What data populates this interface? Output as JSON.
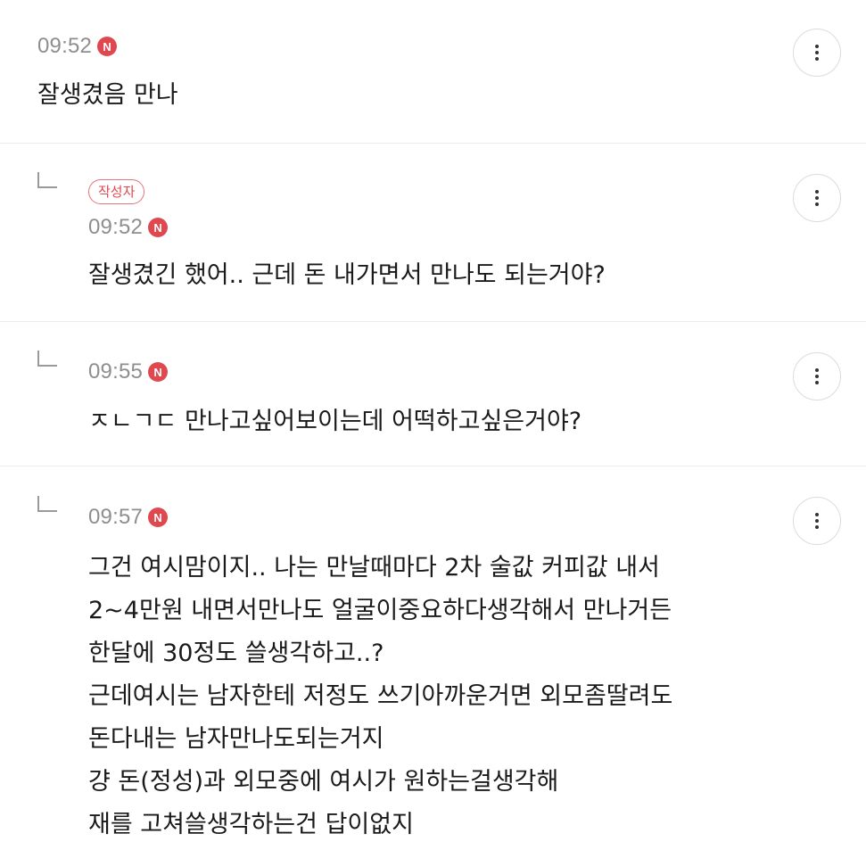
{
  "comments": [
    {
      "time": "09:52",
      "new_badge": "N",
      "text": "잘생겼음 만나"
    },
    {
      "author_badge": "작성자",
      "time": "09:52",
      "new_badge": "N",
      "text": "잘생겼긴 했어.. 근데 돈 내가면서 만나도 되는거야?"
    },
    {
      "time": "09:55",
      "new_badge": "N",
      "text": "ㅈㄴㄱㄷ 만나고싶어보이는데 어떡하고싶은거야?"
    },
    {
      "time": "09:57",
      "new_badge": "N",
      "lines": [
        "그건 여시맘이지.. 나는 만날때마다 2차 술값 커피값 내서",
        "2~4만원 내면서만나도 얼굴이중요하다생각해서 만나거든",
        "한달에 30정도 쓸생각하고..?",
        "근데여시는 남자한테 저정도 쓰기아까운거면 외모좀딸려도",
        "돈다내는 남자만나도되는거지",
        "걍 돈(정성)과 외모중에 여시가 원하는걸생각해",
        "재를 고쳐쓸생각하는건 답이없지"
      ]
    }
  ]
}
